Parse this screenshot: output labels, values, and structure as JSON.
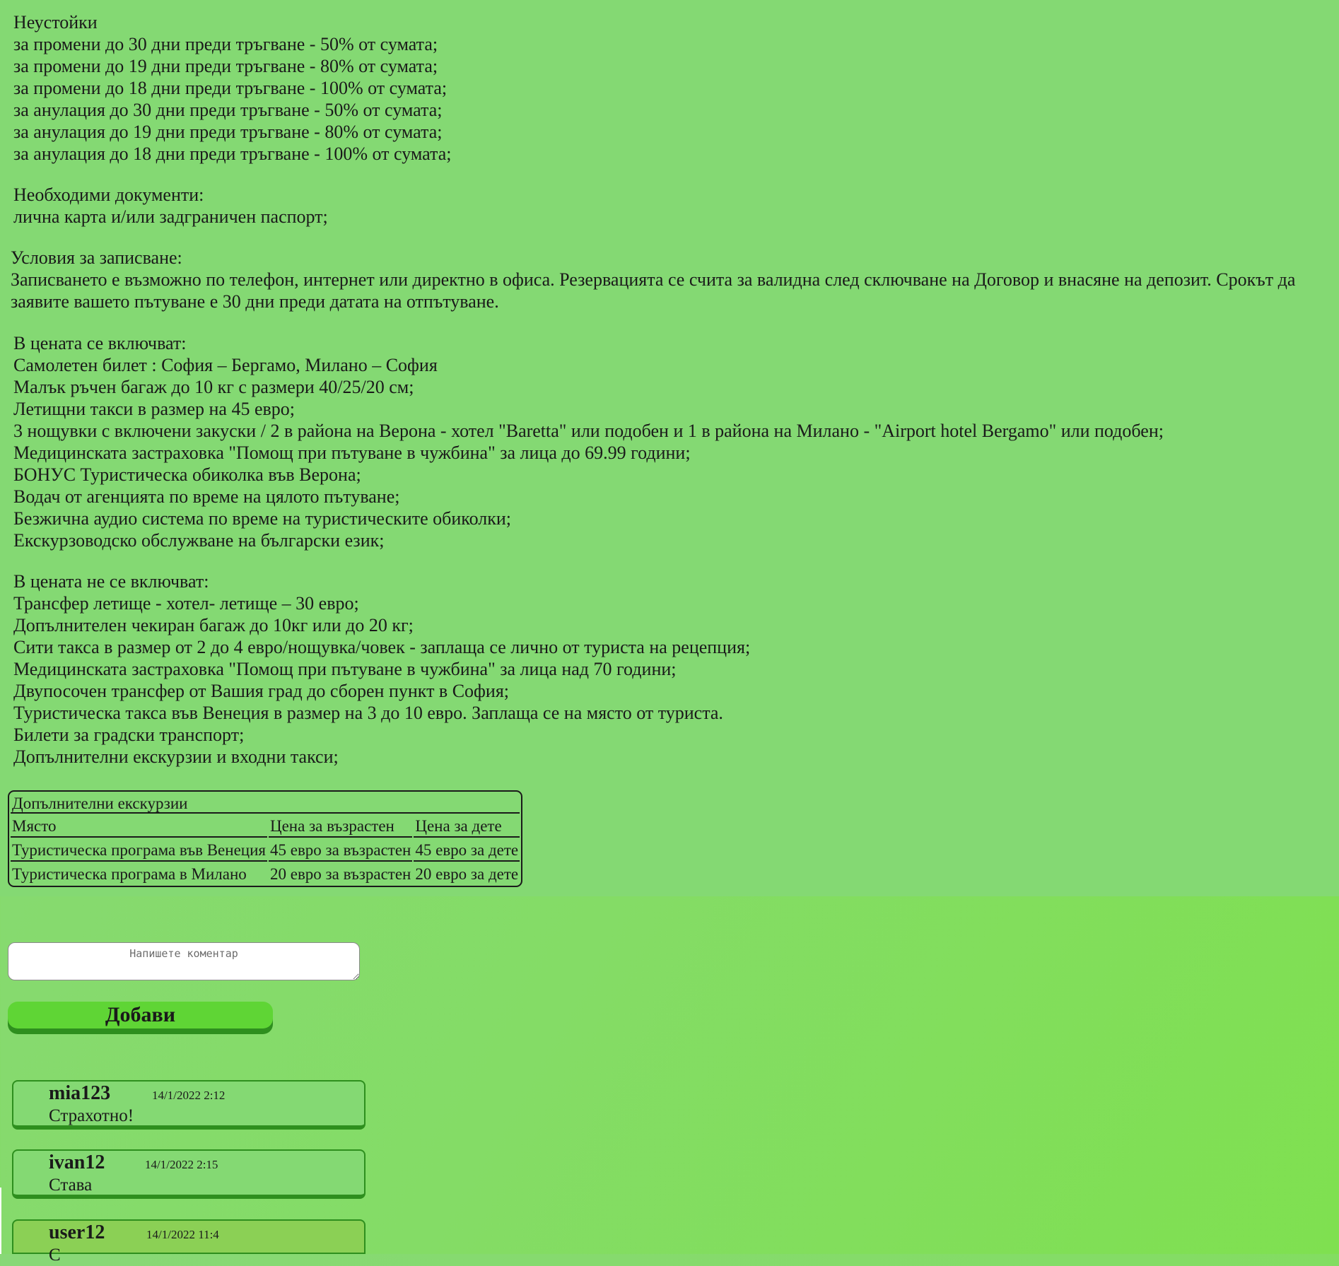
{
  "penalties": {
    "heading": "Неустойки",
    "items": [
      "за промени до 30 дни преди тръгване - 50% от сумата;",
      "за промени до 19 дни преди тръгване - 80% от сумата;",
      "за промени до 18 дни преди тръгване - 100% от сумата;",
      "за анулация до 30 дни преди тръгване - 50% от сумата;",
      "за анулация до 19 дни преди тръгване - 80% от сумата;",
      "за анулация до 18 дни преди тръгване - 100% от сумата;"
    ]
  },
  "documents": {
    "heading": "Необходими документи:",
    "items": [
      "лична карта и/или задграничен паспорт;"
    ]
  },
  "conditions": {
    "heading": "Условия за записване:",
    "text": "Записването е възможно по телефон, интернет или директно в офиса. Резервацията се счита за валидна след сключване на Договор и внасяне на депозит. Срокът да заявите вашето пътуване е 30 дни преди датата на отпътуване."
  },
  "included": {
    "heading": "В цената се включват:",
    "items": [
      "Самолетен билет : София – Бергамо, Милано – София",
      "Малък ръчен багаж до 10 кг с размери 40/25/20 см;",
      "Летищни такси в размер на 45 евро;",
      "3 нощувки с включени закуски / 2 в района на Верона - хотел \"Baretta\" или подобен и 1 в района на Милано - \"Airport hotel Bergamo\" или подобен;",
      "Медицинската застраховка \"Помощ при пътуване в чужбина\" за лица до 69.99 години;",
      "БОНУС Туристическа обиколка във Верона;",
      "Водач от агенцията по време на цялото пътуване;",
      "Безжична аудио система по време на туристическите обиколки;",
      "Екскурзоводско обслужване на български език;"
    ]
  },
  "not_included": {
    "heading": "В цената не се включват:",
    "items": [
      "Трансфер летище - хотел- летище – 30 евро;",
      "Допълнителен чекиран багаж до 10кг или до 20 кг;",
      "Сити такса в размер от 2 до 4 евро/нощувка/човек - заплаща се лично от туриста на рецепция;",
      "Медицинската застраховка \"Помощ при пътуване в чужбина\" за лица над 70 години;",
      "Двупосочен трансфер от Вашия град до сборен пункт в София;",
      "Туристическа такса във Венеция в размер на 3 до 10 евро. Заплаща се на място от туриста.",
      "Билети за градски транспорт;",
      "Допълнителни екскурзии и входни такси;"
    ]
  },
  "excursions_table": {
    "caption": "Допълнителни екскурзии",
    "headers": [
      "Място",
      "Цена за възрастен",
      "Цена за дете"
    ],
    "rows": [
      [
        "Туристическа програма във Венеция",
        "45 евро за възрастен",
        "45 евро за дете"
      ],
      [
        "Туристическа програма в Милано",
        "20 евро за възрастен",
        "20 евро за дете"
      ]
    ]
  },
  "comment_form": {
    "placeholder": "Напишете коментар",
    "submit_label": "Добави"
  },
  "comments": [
    {
      "author": "mia123",
      "time": "14/1/2022 2:12",
      "text": "Страхотно!"
    },
    {
      "author": "ivan12",
      "time": "14/1/2022 2:15",
      "text": "Става"
    },
    {
      "author": "user12",
      "time": "14/1/2022 11:4",
      "text": "С"
    }
  ],
  "colors": {
    "page_background": "#84d973",
    "accent_green": "#5fd535",
    "border_green": "#2e8f1e",
    "text": "#1a1a1a"
  }
}
